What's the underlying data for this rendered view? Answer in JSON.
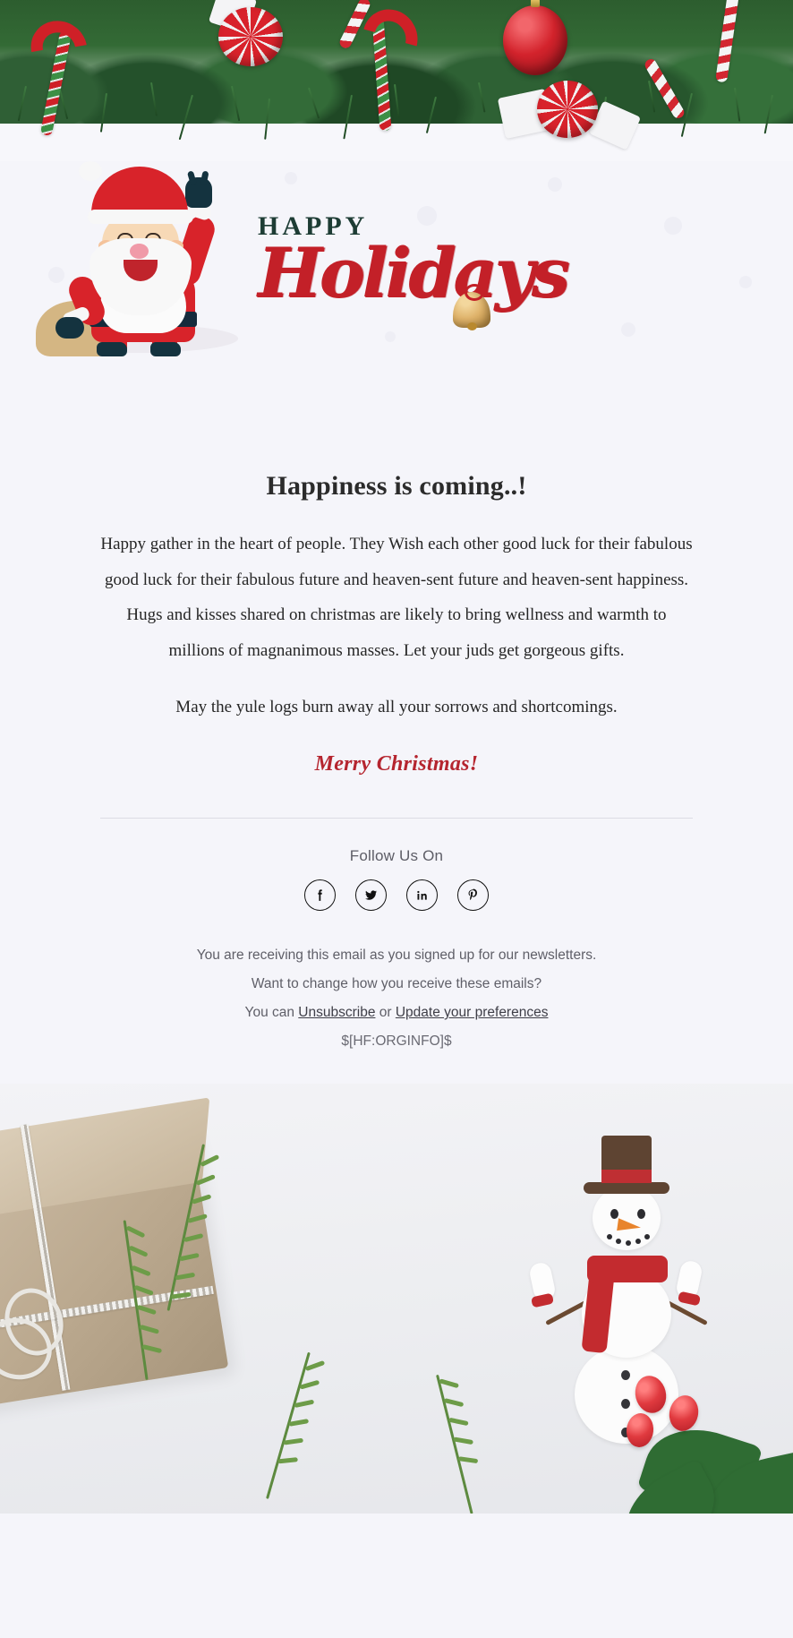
{
  "banner": {
    "alt_top": "christmas-garland-with-candy-canes-banner",
    "alt_bottom": "gift-box-snowman-holly-banner"
  },
  "header_art": {
    "word_happy": "HAPPY",
    "word_holidays": "Holidays",
    "santa_alt": "waving-santa-with-gift-sack"
  },
  "content": {
    "headline": "Happiness is coming..!",
    "paragraph_1": "Happy gather in the heart of people. They Wish each other good luck for their fabulous good luck for their fabulous future and heaven-sent future and heaven-sent happiness. Hugs and kisses shared on christmas are likely to bring wellness and warmth to millions of magnanimous masses. Let your juds get gorgeous gifts.",
    "paragraph_2": "May the yule logs burn away all your sorrows and shortcomings.",
    "closing": "Merry Christmas!"
  },
  "social": {
    "label": "Follow Us On",
    "items": [
      {
        "name": "facebook",
        "title": "Facebook"
      },
      {
        "name": "twitter",
        "title": "Twitter"
      },
      {
        "name": "linkedin",
        "title": "LinkedIn"
      },
      {
        "name": "pinterest",
        "title": "Pinterest"
      }
    ]
  },
  "footer": {
    "line_1": "You are receiving this email as you signed up for our newsletters.",
    "line_2": "Want to change how you receive these emails?",
    "line_3_prefix": "You can ",
    "unsubscribe": "Unsubscribe",
    "line_3_middle": " or ",
    "update_preferences": "Update your preferences",
    "orginfo": "$[HF:ORGINFO]$"
  },
  "colors": {
    "page_background": "#f5f5fa",
    "holidays_red": "#c32028",
    "happy_green": "#1d3c34",
    "merry_red": "#b5252f",
    "headline": "#2b2b2b",
    "body_text": "#262626",
    "muted_text": "#5f5f68",
    "divider": "#dcdce4"
  }
}
